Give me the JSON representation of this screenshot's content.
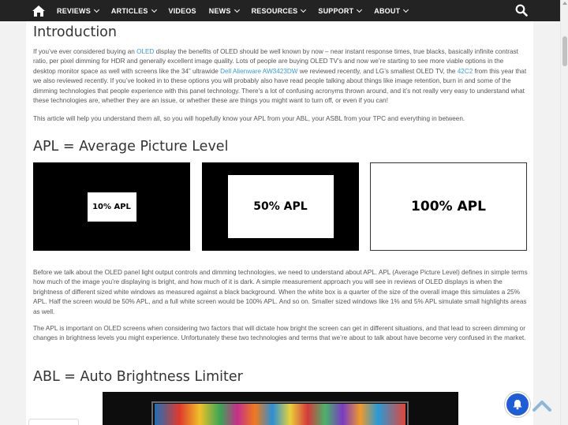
{
  "nav": {
    "items": [
      {
        "label": "REVIEWS",
        "dropdown": true
      },
      {
        "label": "ARTICLES",
        "dropdown": true
      },
      {
        "label": "VIDEOS",
        "dropdown": false
      },
      {
        "label": "NEWS",
        "dropdown": true
      },
      {
        "label": "RESOURCES",
        "dropdown": true
      },
      {
        "label": "SUPPORT",
        "dropdown": true
      },
      {
        "label": "ABOUT",
        "dropdown": true
      }
    ]
  },
  "article": {
    "intro_heading": "Introduction",
    "intro_p1": {
      "t1": "If you’ve ever considered buying an ",
      "link1": "OLED",
      "t2": " display the benefits of OLED should be well known by now – near instant response times, true blacks, basically infinite contrast ratio, per pixel dimming for HDR and generally excellent image quality. Lots of people are buying OLED TV’s and now we’re starting to see more viable options in the desktop monitor space as well with screens like the 34” ultrawide ",
      "link2": "Dell Alienware AW3423DW",
      "t3": " we reviewed recently, and LG’s smallest OLED TV, the ",
      "link3": "42C2",
      "t4": " from this year that we also reviewed recently. If you’ve looked in to these options you will probably also have read people talking about things like image retention, burn in and some of the dimming technologies that people experience with this panel technology. There’s a lot of confusing acronyms thrown around, and it’s not really very easy to understand what these technologies are, whether they are an issue, or whether these are things you might want to turn off, or even if you can!"
    },
    "intro_p2": "This article will help you understand them all, so you will hopefully know your APL from your ABL, your ASBL from your TPC and everything in between.",
    "apl_heading": "APL = Average Picture Level",
    "apl_images": [
      "10% APL",
      "50% APL",
      "100% APL"
    ],
    "apl_p1": "Before we talk about the OLED panel light output controls and dimming technologies, we need to understand about APL. APL (Average Picture Level) defines in simple terms how much of the image you’re displaying is bright, and how much of it is dark. A simple measurement approach you will see in reviews of OLED displays is when the brightness of different sized white windows as measured against a black background. When the white box is a quarter of the size of the overall image this simulates a 25% APL. Half the screen would be 50% APL, and a full white screen would be 100% APL. And so on. Smaller sized windows like 1% and 5% APL simulate small highlights areas as well.",
    "apl_p2": "The APL is important on OLED screens when considering two factors that will dictate how bright the screen can get in different situations, and that lead to screen dimming or changes in brightness levels you might experience. Unfortunately these two technologies and terms that we’re about to talk about have become very confused in the market.",
    "abl_heading": "ABL = Auto Brightness Limiter"
  },
  "colors": {
    "nav_bg": "#232323",
    "link": "#3a9bd8",
    "bell": "#1e5dd8",
    "back_to_top": "#8fb6d6"
  }
}
